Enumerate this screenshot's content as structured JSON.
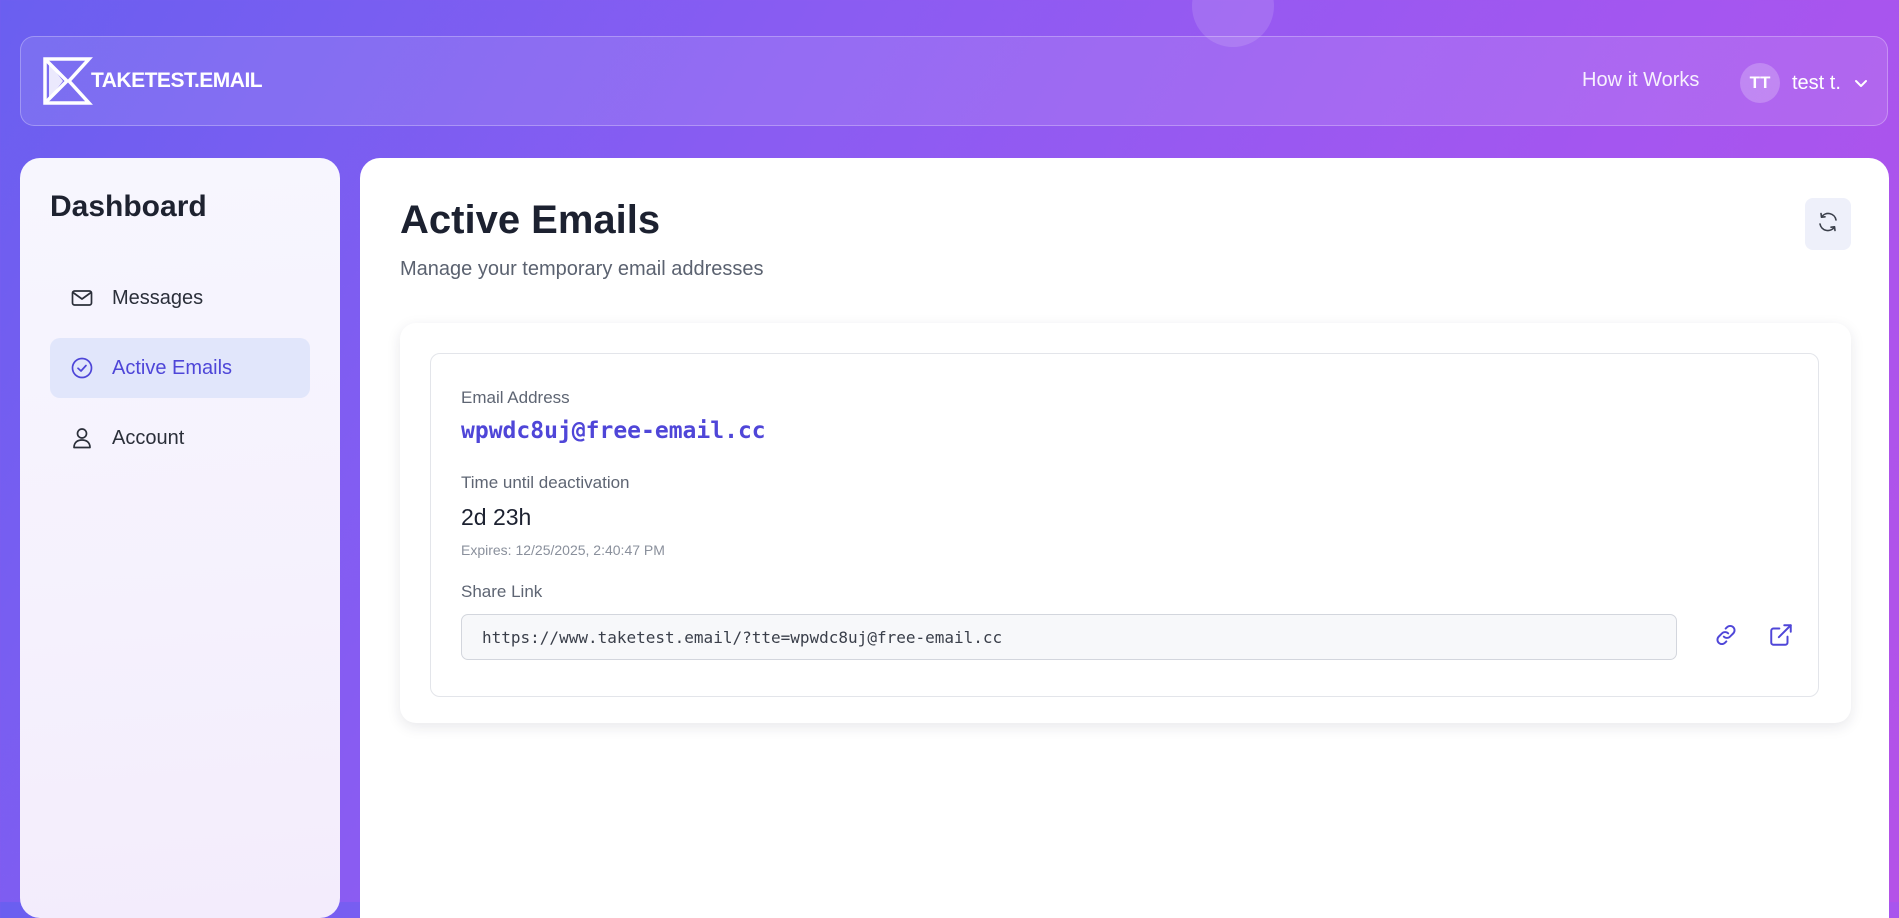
{
  "app": {
    "logo_text": "TAKETEST.EMAIL"
  },
  "header": {
    "nav_link": "How it Works",
    "user_initials": "TT",
    "user_name": "test t."
  },
  "sidebar": {
    "title": "Dashboard",
    "items": [
      {
        "label": "Messages",
        "icon": "mail-icon",
        "active": false
      },
      {
        "label": "Active Emails",
        "icon": "check-circle-icon",
        "active": true
      },
      {
        "label": "Account",
        "icon": "user-icon",
        "active": false
      }
    ]
  },
  "main": {
    "title": "Active Emails",
    "subtitle": "Manage your temporary email addresses",
    "refresh_icon": "refresh-icon"
  },
  "email_card": {
    "email_label": "Email Address",
    "email": "wpwdc8uj@free-email.cc",
    "time_label": "Time until deactivation",
    "time_left": "2d 23h",
    "expires": "Expires: 12/25/2025, 2:40:47 PM",
    "share_label": "Share Link",
    "share_url": "https://www.taketest.email/?tte=wpwdc8uj@free-email.cc",
    "copy_icon": "link-icon",
    "open_icon": "external-link-icon"
  },
  "colors": {
    "accent": "#4f46d8",
    "active_item_bg": "#e1e6fb",
    "gradient_start": "#6a5ff0",
    "gradient_end": "#b452e8"
  }
}
